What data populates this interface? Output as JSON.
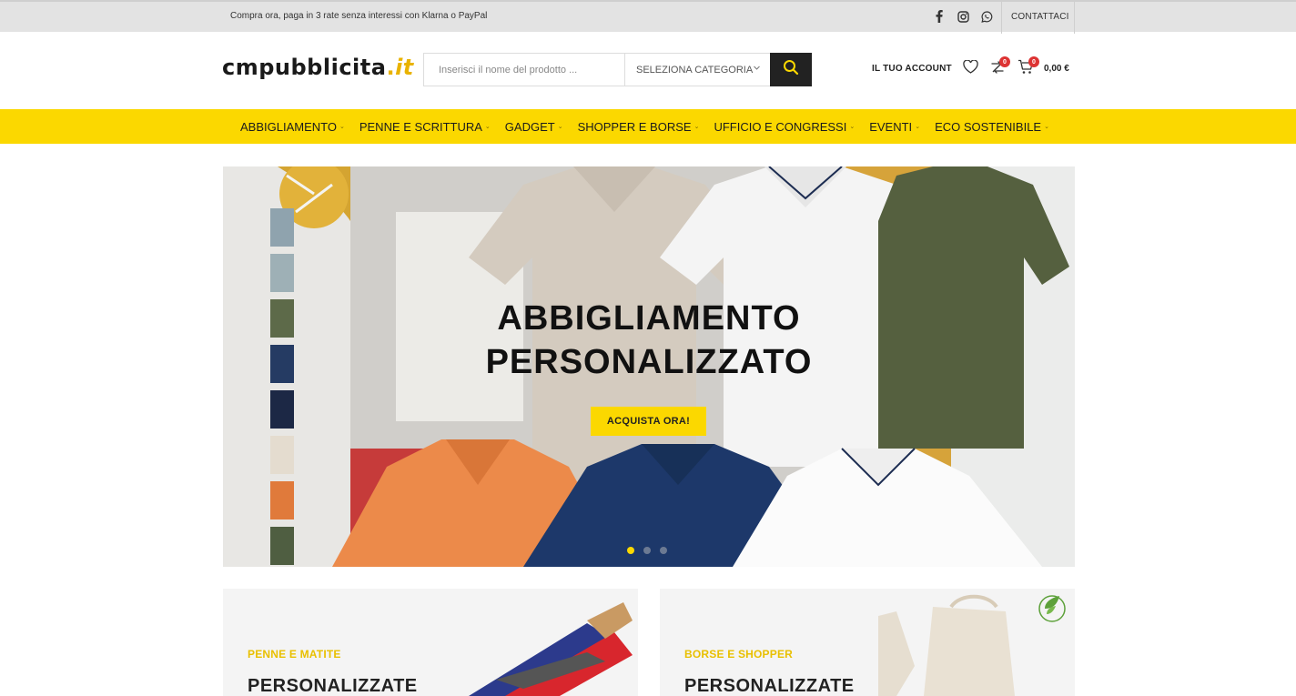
{
  "topbar": {
    "promo": "Compra ora, paga in 3 rate senza interessi con Klarna o PayPal",
    "socials": [
      "facebook-icon",
      "instagram-icon",
      "whatsapp-icon"
    ],
    "contact": "CONTATTACI"
  },
  "header": {
    "logo_main": "cmpubblicita",
    "logo_dot": ".",
    "logo_tld": "it",
    "search_placeholder": "Inserisci il nome del prodotto ...",
    "category_select": "SELEZIONA CATEGORIA",
    "account": "IL TUO ACCOUNT",
    "compare_count": "0",
    "cart_count": "0",
    "cart_total": "0,00 €"
  },
  "nav": {
    "items": [
      {
        "label": "ABBIGLIAMENTO"
      },
      {
        "label": "PENNE E SCRITTURA"
      },
      {
        "label": "GADGET"
      },
      {
        "label": "SHOPPER E BORSE"
      },
      {
        "label": "UFFICIO E CONGRESSI"
      },
      {
        "label": "EVENTI"
      },
      {
        "label": "ECO SOSTENIBILE"
      }
    ]
  },
  "hero": {
    "title_line1": "ABBIGLIAMENTO",
    "title_line2": "PERSONALIZZATO",
    "cta": "ACQUISTA ORA!",
    "slides": 3,
    "active_slide": 1
  },
  "cards": [
    {
      "sub": "PENNE E MATITE",
      "head": "PERSONALIZZATE"
    },
    {
      "sub": "BORSE E SHOPPER",
      "head": "PERSONALIZZATE"
    }
  ],
  "colors": {
    "accent": "#fbd800",
    "dark": "#222222",
    "badge": "#dd3333"
  }
}
